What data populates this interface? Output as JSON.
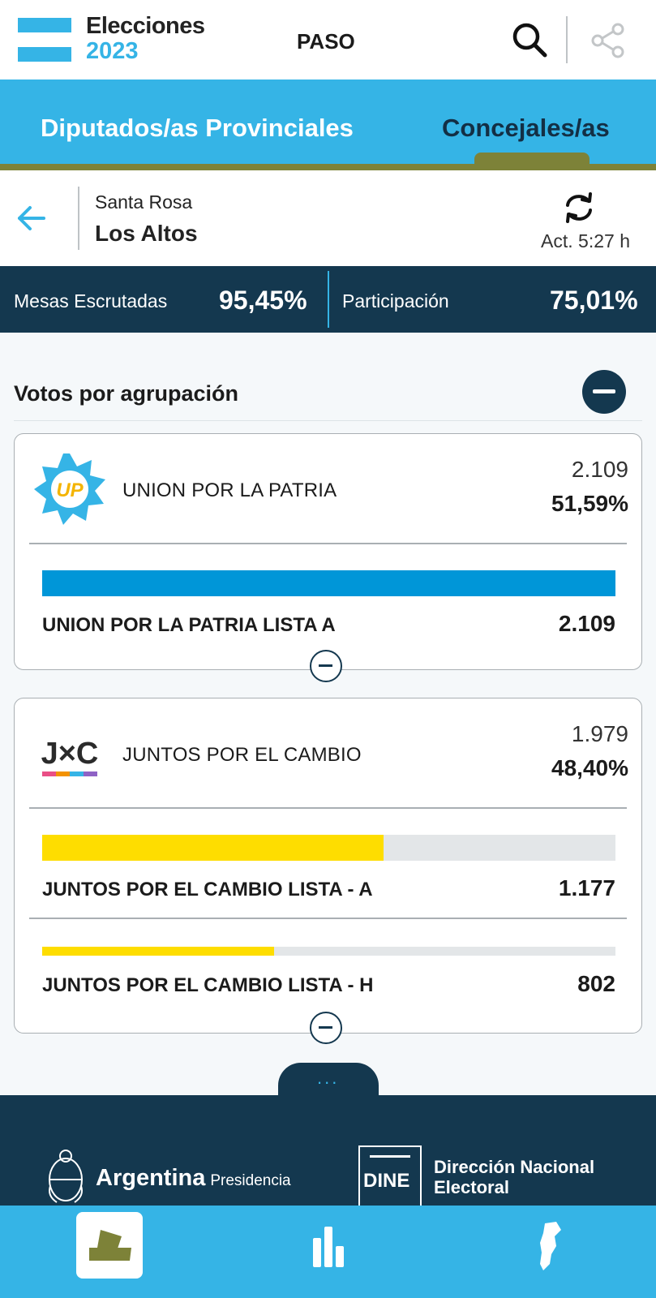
{
  "header": {
    "brand_line1": "Elecciones",
    "brand_line2": "2023",
    "election_type": "PASO",
    "icons": [
      "search-icon",
      "share-icon"
    ]
  },
  "tabs": [
    {
      "label": "Diputados/as Provinciales",
      "active": false
    },
    {
      "label": "Concejales/as",
      "active": true
    }
  ],
  "location": {
    "parent": "Santa Rosa",
    "name": "Los Altos",
    "updated": "Act. 5:27 h"
  },
  "stats": {
    "mesas_label": "Mesas Escrutadas",
    "mesas_value": "95,45%",
    "participacion_label": "Participación",
    "participacion_value": "75,01%"
  },
  "section": {
    "title": "Votos por agrupación"
  },
  "parties": [
    {
      "name": "UNION POR LA PATRIA",
      "logo_text": "UP",
      "votes": "2.109",
      "pct": "51,59%",
      "color": "#0096d8",
      "lists": [
        {
          "name": "UNION POR LA PATRIA LISTA A",
          "votes": "2.109",
          "fill": 1.0
        }
      ]
    },
    {
      "name": "JUNTOS POR EL CAMBIO",
      "logo_text": "J×C",
      "votes": "1.979",
      "pct": "48,40%",
      "color": "#fedd00",
      "lists": [
        {
          "name": "JUNTOS POR EL CAMBIO LISTA - A",
          "votes": "1.177",
          "fill": 0.595
        },
        {
          "name": "JUNTOS POR EL CAMBIO LISTA - H",
          "votes": "802",
          "fill": 0.405
        }
      ]
    }
  ],
  "footer": {
    "more": "...",
    "argentina": "Argentina",
    "presidencia": "Presidencia",
    "dine_abbr": "DINE",
    "dine_line1": "Dirección Nacional",
    "dine_line2": "Electoral"
  },
  "colors": {
    "accent": "#35b4e6",
    "dark": "#14384f",
    "olive": "#7d8238"
  }
}
